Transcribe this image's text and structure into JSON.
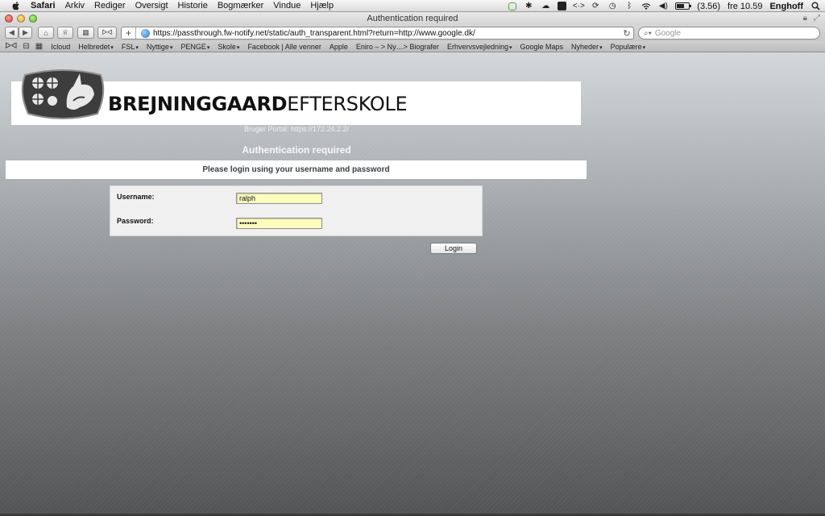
{
  "menubar": {
    "app": "Safari",
    "items": [
      "Arkiv",
      "Rediger",
      "Oversigt",
      "Historie",
      "Bogmærker",
      "Vindue",
      "Hjælp"
    ],
    "battery_text": "(3.56)",
    "battery_level": 0.6,
    "clock": "fre 10.59",
    "user": "Enghoff"
  },
  "window": {
    "title": "Authentication required"
  },
  "toolbar": {
    "url": "https://passthrough.fw-notify.net/static/auth_transparent.html?return=http://www.google.dk/",
    "search_placeholder": "Google"
  },
  "bookmarks": [
    {
      "label": "Icloud",
      "menu": false
    },
    {
      "label": "Helbredet",
      "menu": true
    },
    {
      "label": "FSL",
      "menu": true
    },
    {
      "label": "Nyttige",
      "menu": true
    },
    {
      "label": "PENGE",
      "menu": true
    },
    {
      "label": "Skole",
      "menu": true
    },
    {
      "label": "Facebook | Alle venner",
      "menu": false
    },
    {
      "label": "Apple",
      "menu": false
    },
    {
      "label": "Eniro – > Ny…> Biografer",
      "menu": false
    },
    {
      "label": "Erhvervsvejledning",
      "menu": true
    },
    {
      "label": "Google Maps",
      "menu": false
    },
    {
      "label": "Nyheder",
      "menu": true
    },
    {
      "label": "Populære",
      "menu": true
    }
  ],
  "page": {
    "school_bold": "BREJNINGGAARD",
    "school_light": "EFTERSKOLE",
    "portal": "Bruger Portal: https://172.24.2.2/",
    "auth_title": "Authentication required",
    "info": "Please login using your username and password",
    "username_label": "Username:",
    "username_value": "ralph",
    "password_label": "Password:",
    "password_value": "•••••••",
    "login_label": "Login"
  }
}
